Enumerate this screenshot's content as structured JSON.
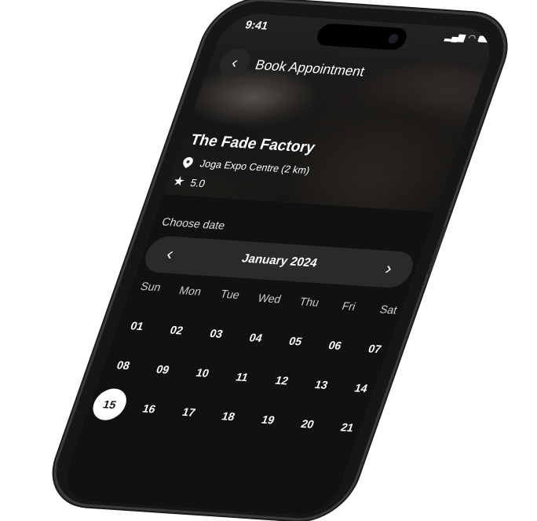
{
  "status_bar": {
    "time": "9:41",
    "signal": "signal-icon",
    "wifi": "wifi-icon",
    "battery": "battery-icon"
  },
  "header": {
    "back_icon": "‹",
    "title": "Book Appointment"
  },
  "shop": {
    "name": "The Fade Factory",
    "location": "Joga Expo Centre  (2 km)",
    "rating": "5.0"
  },
  "calendar": {
    "label": "Choose date",
    "month": "January 2024",
    "prev": "‹",
    "next": "›",
    "weekdays": [
      "Sun",
      "Mon",
      "Tue",
      "Wed",
      "Thu",
      "Fri",
      "Sat"
    ],
    "weeks": [
      [
        "01",
        "02",
        "03",
        "04",
        "05",
        "06",
        "07"
      ],
      [
        "08",
        "09",
        "10",
        "11",
        "12",
        "13",
        "14"
      ],
      [
        "15",
        "16",
        "17",
        "18",
        "19",
        "20",
        "21"
      ]
    ],
    "selected": "15"
  }
}
